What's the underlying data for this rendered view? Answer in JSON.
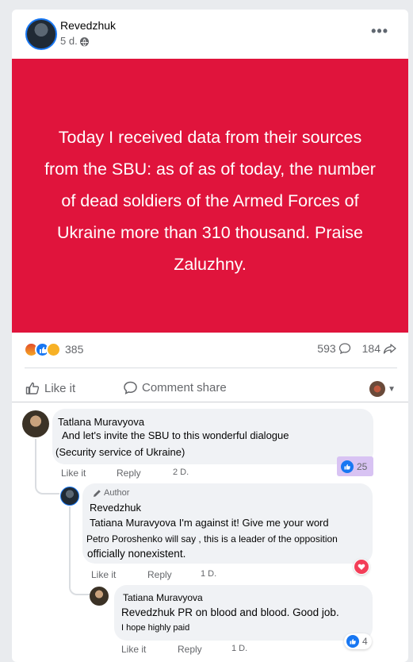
{
  "post": {
    "author": "Revedzhuk",
    "time": "5 d.",
    "more_label": "•••",
    "banner_text": "Today I received data from their sources from the SBU: as of as of today, the number of dead soldiers of the Armed Forces of Ukraine more than 310 thousand. Praise Zaluzhny.",
    "banner_color": "#e0143c",
    "reaction_count": "385",
    "comment_count": "593",
    "share_count": "184",
    "reaction_icons": [
      "angry-icon",
      "like-icon",
      "sad-icon"
    ]
  },
  "actions": {
    "like_label": "Like it",
    "comment_label": "Comment share"
  },
  "comments": [
    {
      "name": "Tatlana Muravyova",
      "text_line1": "And let's invite the SBU to this wonderful dialogue",
      "text_line2": "(Security service of Ukraine)",
      "like": "Like it",
      "reply": "Reply",
      "time": "2 D.",
      "reactions": "25"
    },
    {
      "author_tag": "Author",
      "name": "Revedzhuk",
      "text_line1": "Tatiana Muravyova I'm against it! Give me your word",
      "text_line2": "Petro Poroshenko will say , this is a leader of the opposition",
      "text_line3": "officially nonexistent.",
      "like": "Like it",
      "reply": "Reply",
      "time": "1 D."
    },
    {
      "name": "Tatiana Muravyova",
      "text_line1": "Revedzhuk PR on blood and blood. Good job.",
      "text_line2": "I hope highly paid",
      "like": "Like it",
      "reply": "Reply",
      "time": "1 D.",
      "reactions": "4"
    }
  ],
  "colors": {
    "accent": "#1877f2",
    "heart": "#f33e58",
    "highlight": "#d8c3f3"
  }
}
